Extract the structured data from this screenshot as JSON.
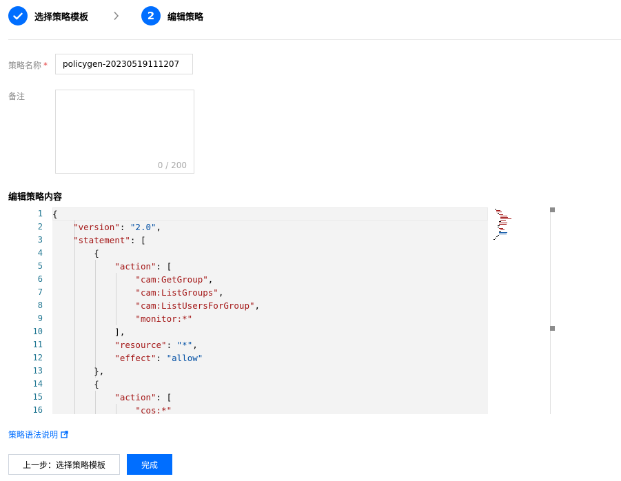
{
  "steps": [
    {
      "number": "",
      "label": "选择策略模板",
      "status": "done"
    },
    {
      "number": "2",
      "label": "编辑策略",
      "status": "active"
    }
  ],
  "form": {
    "name_label": "策略名称",
    "required_mark": "*",
    "name_value": "policygen-20230519111207",
    "remark_label": "备注",
    "remark_value": "",
    "remark_counter": "0 / 200"
  },
  "editor": {
    "section_title": "编辑策略内容",
    "line_numbers": [
      "1",
      "2",
      "3",
      "4",
      "5",
      "6",
      "7",
      "8",
      "9",
      "10",
      "11",
      "12",
      "13",
      "14",
      "15",
      "16"
    ],
    "lines": [
      [
        {
          "t": "p",
          "v": "{"
        }
      ],
      [
        {
          "t": "p",
          "v": "    "
        },
        {
          "t": "k",
          "v": "\"version\""
        },
        {
          "t": "p",
          "v": ": "
        },
        {
          "t": "s",
          "v": "\"2.0\""
        },
        {
          "t": "p",
          "v": ","
        }
      ],
      [
        {
          "t": "p",
          "v": "    "
        },
        {
          "t": "k",
          "v": "\"statement\""
        },
        {
          "t": "p",
          "v": ": ["
        }
      ],
      [
        {
          "t": "p",
          "v": "        {"
        }
      ],
      [
        {
          "t": "p",
          "v": "            "
        },
        {
          "t": "k",
          "v": "\"action\""
        },
        {
          "t": "p",
          "v": ": ["
        }
      ],
      [
        {
          "t": "p",
          "v": "                "
        },
        {
          "t": "k",
          "v": "\"cam:GetGroup\""
        },
        {
          "t": "p",
          "v": ","
        }
      ],
      [
        {
          "t": "p",
          "v": "                "
        },
        {
          "t": "k",
          "v": "\"cam:ListGroups\""
        },
        {
          "t": "p",
          "v": ","
        }
      ],
      [
        {
          "t": "p",
          "v": "                "
        },
        {
          "t": "k",
          "v": "\"cam:ListUsersForGroup\""
        },
        {
          "t": "p",
          "v": ","
        }
      ],
      [
        {
          "t": "p",
          "v": "                "
        },
        {
          "t": "k",
          "v": "\"monitor:*\""
        }
      ],
      [
        {
          "t": "p",
          "v": "            ],"
        }
      ],
      [
        {
          "t": "p",
          "v": "            "
        },
        {
          "t": "k",
          "v": "\"resource\""
        },
        {
          "t": "p",
          "v": ": "
        },
        {
          "t": "s",
          "v": "\"*\""
        },
        {
          "t": "p",
          "v": ","
        }
      ],
      [
        {
          "t": "p",
          "v": "            "
        },
        {
          "t": "k",
          "v": "\"effect\""
        },
        {
          "t": "p",
          "v": ": "
        },
        {
          "t": "s",
          "v": "\"allow\""
        }
      ],
      [
        {
          "t": "p",
          "v": "        },"
        }
      ],
      [
        {
          "t": "p",
          "v": "        {"
        }
      ],
      [
        {
          "t": "p",
          "v": "            "
        },
        {
          "t": "k",
          "v": "\"action\""
        },
        {
          "t": "p",
          "v": ": ["
        }
      ],
      [
        {
          "t": "p",
          "v": "                "
        },
        {
          "t": "k",
          "v": "\"cos:*\""
        }
      ]
    ]
  },
  "help_link": {
    "label": "策略语法说明",
    "icon": "external-link-icon"
  },
  "buttons": {
    "prev_label": "上一步：选择策略模板",
    "done_label": "完成"
  },
  "colors": {
    "primary": "#006eff",
    "key": "#a31515",
    "string": "#0451a5",
    "line_number": "#237893",
    "required": "#e54545"
  }
}
